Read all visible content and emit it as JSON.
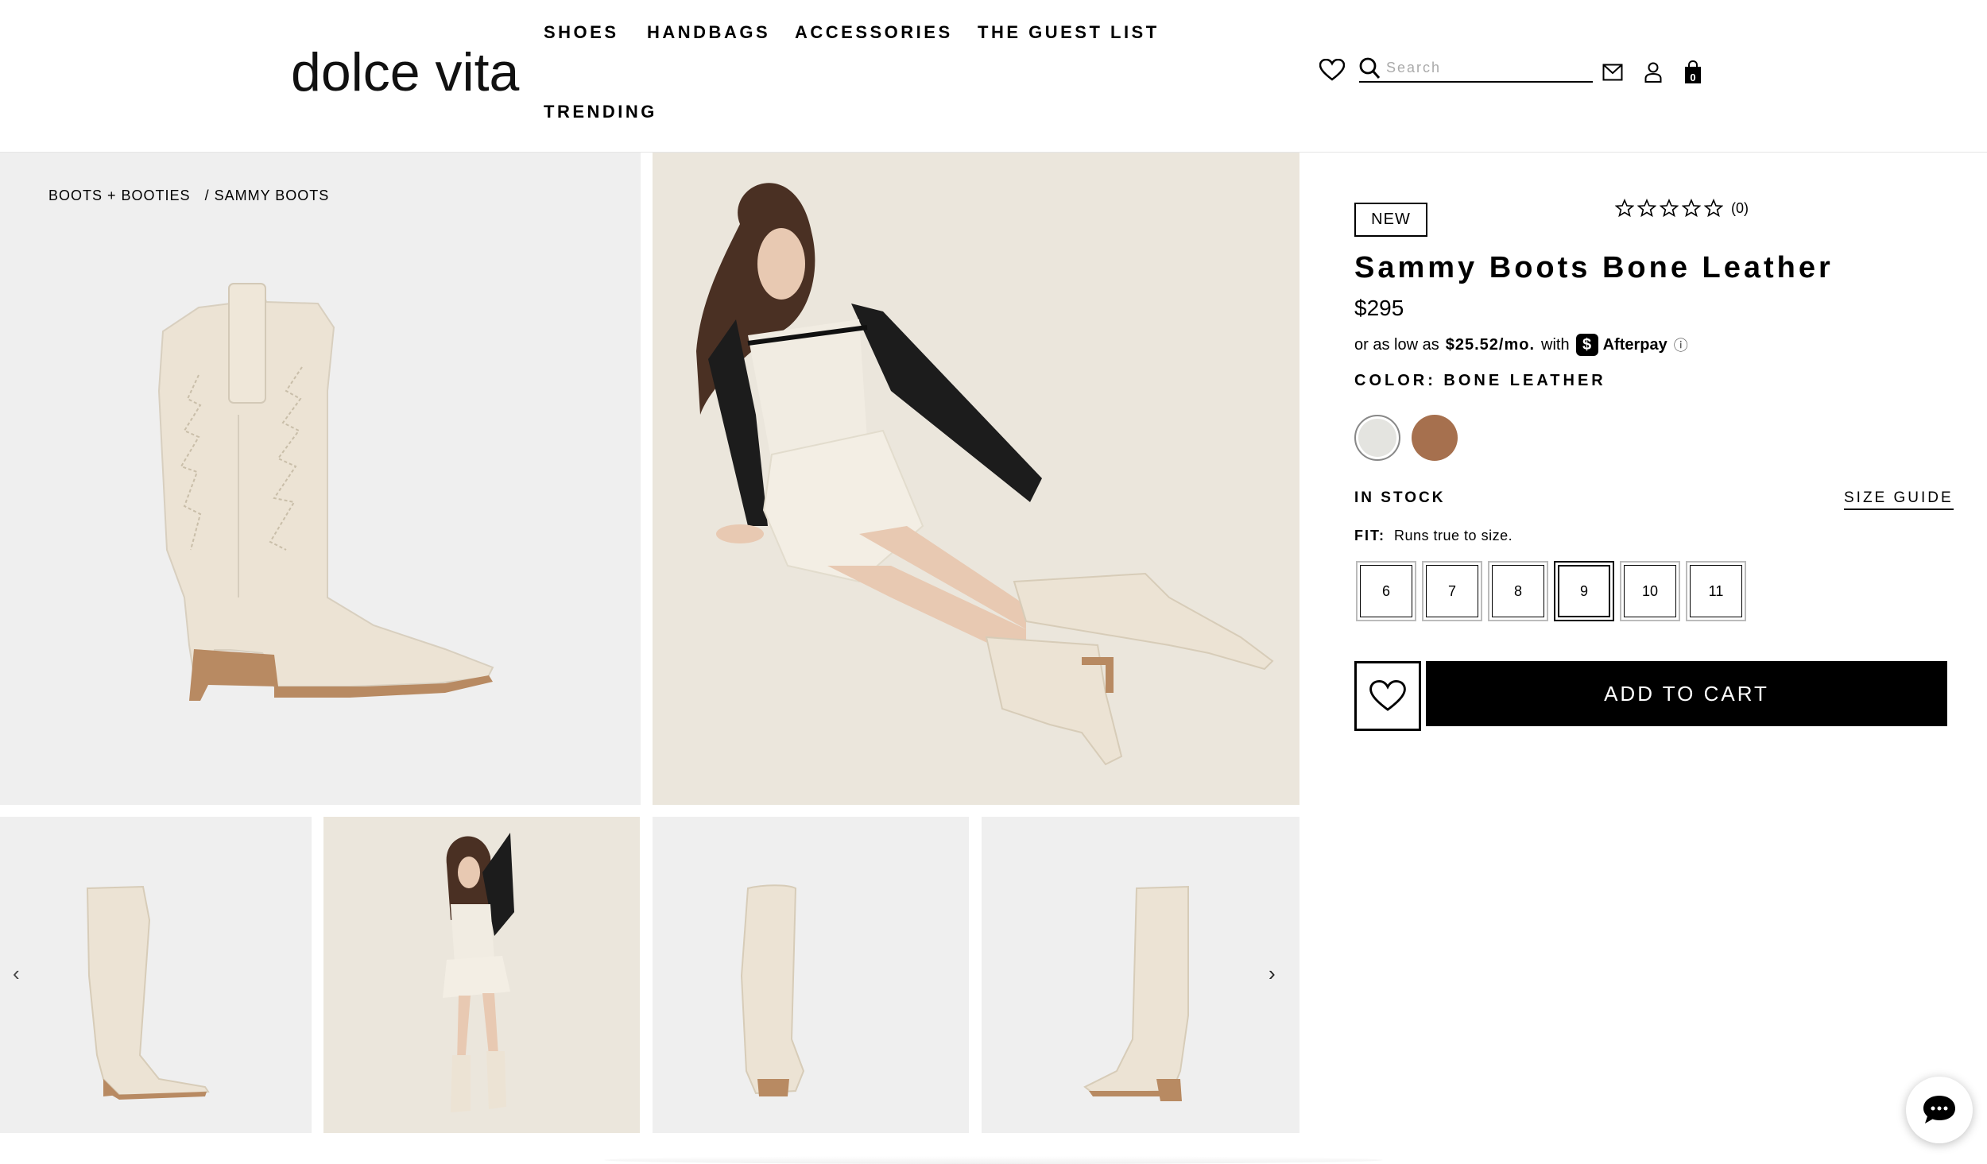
{
  "brand": {
    "logo_text": "dolce vita"
  },
  "nav": {
    "items": [
      {
        "label": "SHOES"
      },
      {
        "label": "HANDBAGS"
      },
      {
        "label": "ACCESSORIES"
      },
      {
        "label": "THE GUEST LIST"
      },
      {
        "label": "TRENDING"
      }
    ]
  },
  "header_tools": {
    "search_placeholder": "Search",
    "cart_count": "0",
    "icons": [
      "heart-icon",
      "search-icon",
      "mail-icon",
      "user-icon",
      "bag-icon"
    ]
  },
  "breadcrumb": {
    "items": [
      {
        "label": "BOOTS + BOOTIES"
      },
      {
        "label": "/ SAMMY BOOTS"
      }
    ]
  },
  "gallery": {
    "main_images": [
      "boot-side-view",
      "model-seated-in-boots"
    ],
    "thumbnails": [
      "boot-front-view",
      "model-standing",
      "boot-back-view",
      "boot-angle-view"
    ],
    "prev_arrow": "‹",
    "next_arrow": "›"
  },
  "product": {
    "badge": "NEW",
    "rating": {
      "stars": 0,
      "max": 5,
      "count_text": "(0)"
    },
    "title": "Sammy Boots Bone Leather",
    "price": "$295",
    "afterpay": {
      "prefix": "or as low as",
      "amount": "$25.52/mo.",
      "with": "with",
      "brand": "Afterpay",
      "badge_glyph": "$",
      "info_glyph": "ⓘ"
    },
    "color_label": "COLOR: BONE LEATHER",
    "swatches": [
      {
        "name": "Bone Leather",
        "color": "#e4e4e0",
        "selected": true
      },
      {
        "name": "Brown",
        "color": "#a6704e",
        "selected": false
      }
    ],
    "stock": "IN STOCK",
    "size_guide": "SIZE GUIDE",
    "fit": {
      "label": "FIT:",
      "text": "Runs true to size."
    },
    "sizes": [
      {
        "label": "6",
        "selected": false
      },
      {
        "label": "7",
        "selected": false
      },
      {
        "label": "8",
        "selected": false
      },
      {
        "label": "9",
        "selected": true
      },
      {
        "label": "10",
        "selected": false
      },
      {
        "label": "11",
        "selected": false
      }
    ],
    "add_to_cart": "ADD TO CART"
  },
  "colors": {
    "gallery_bg": "#efefef",
    "photo_bg": "#ebe6dc",
    "boot": "#ece3d4",
    "heel": "#b88a62",
    "black": "#000000"
  }
}
